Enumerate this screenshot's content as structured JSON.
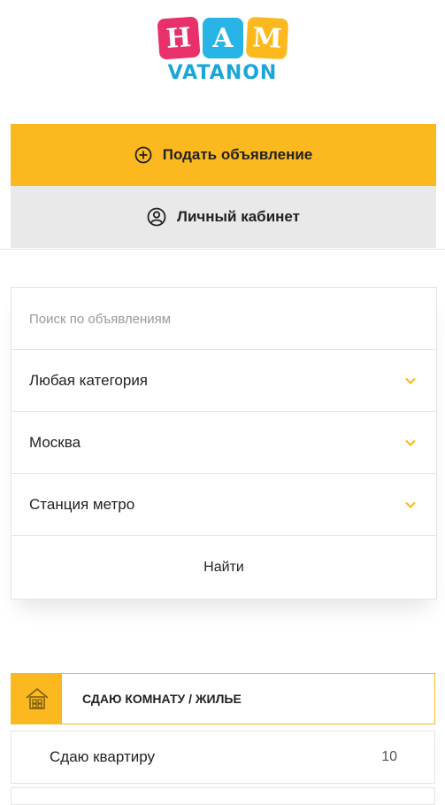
{
  "logo": {
    "letters": [
      "Н",
      "А",
      "М"
    ],
    "subtitle": "VATANON"
  },
  "actions": {
    "post_ad": "Подать объявление",
    "cabinet": "Личный кабинет"
  },
  "search": {
    "placeholder": "Поиск по объявлениям",
    "category": "Любая категория",
    "city": "Москва",
    "metro": "Станция метро",
    "submit": "Найти"
  },
  "categories": [
    {
      "title": "СДАЮ КОМНАТУ / ЖИЛЬЕ",
      "items": [
        {
          "label": "Сдаю квартиру",
          "count": "10"
        }
      ]
    }
  ],
  "colors": {
    "accent": "#fbb91f",
    "logo_pink": "#e8306a",
    "logo_blue": "#28b4e6",
    "subtitle_blue": "#1aa6db"
  }
}
